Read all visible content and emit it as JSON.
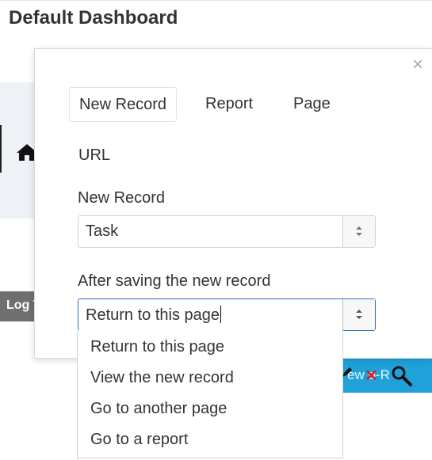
{
  "page": {
    "title": "Default Dashboard",
    "log_button_label": "Log T",
    "toolbar_text": "ew o-R"
  },
  "modal": {
    "tabs": [
      {
        "label": "New Record",
        "active": true
      },
      {
        "label": "Report",
        "active": false
      },
      {
        "label": "Page",
        "active": false
      },
      {
        "label": "URL",
        "active": false
      }
    ],
    "close_symbol": "×",
    "new_record": {
      "label": "New Record",
      "value": "Task"
    },
    "after_saving": {
      "label": "After saving the new record",
      "value": "Return to this page",
      "options": [
        "Return to this page",
        "View the new record",
        "Go to another page",
        "Go to a report"
      ]
    }
  },
  "colors": {
    "toolbar_bg": "#1ea2d9",
    "focus_border": "#2b6fb2",
    "band_bg": "#eef1f6",
    "log_button_bg": "#6f6f6f"
  }
}
